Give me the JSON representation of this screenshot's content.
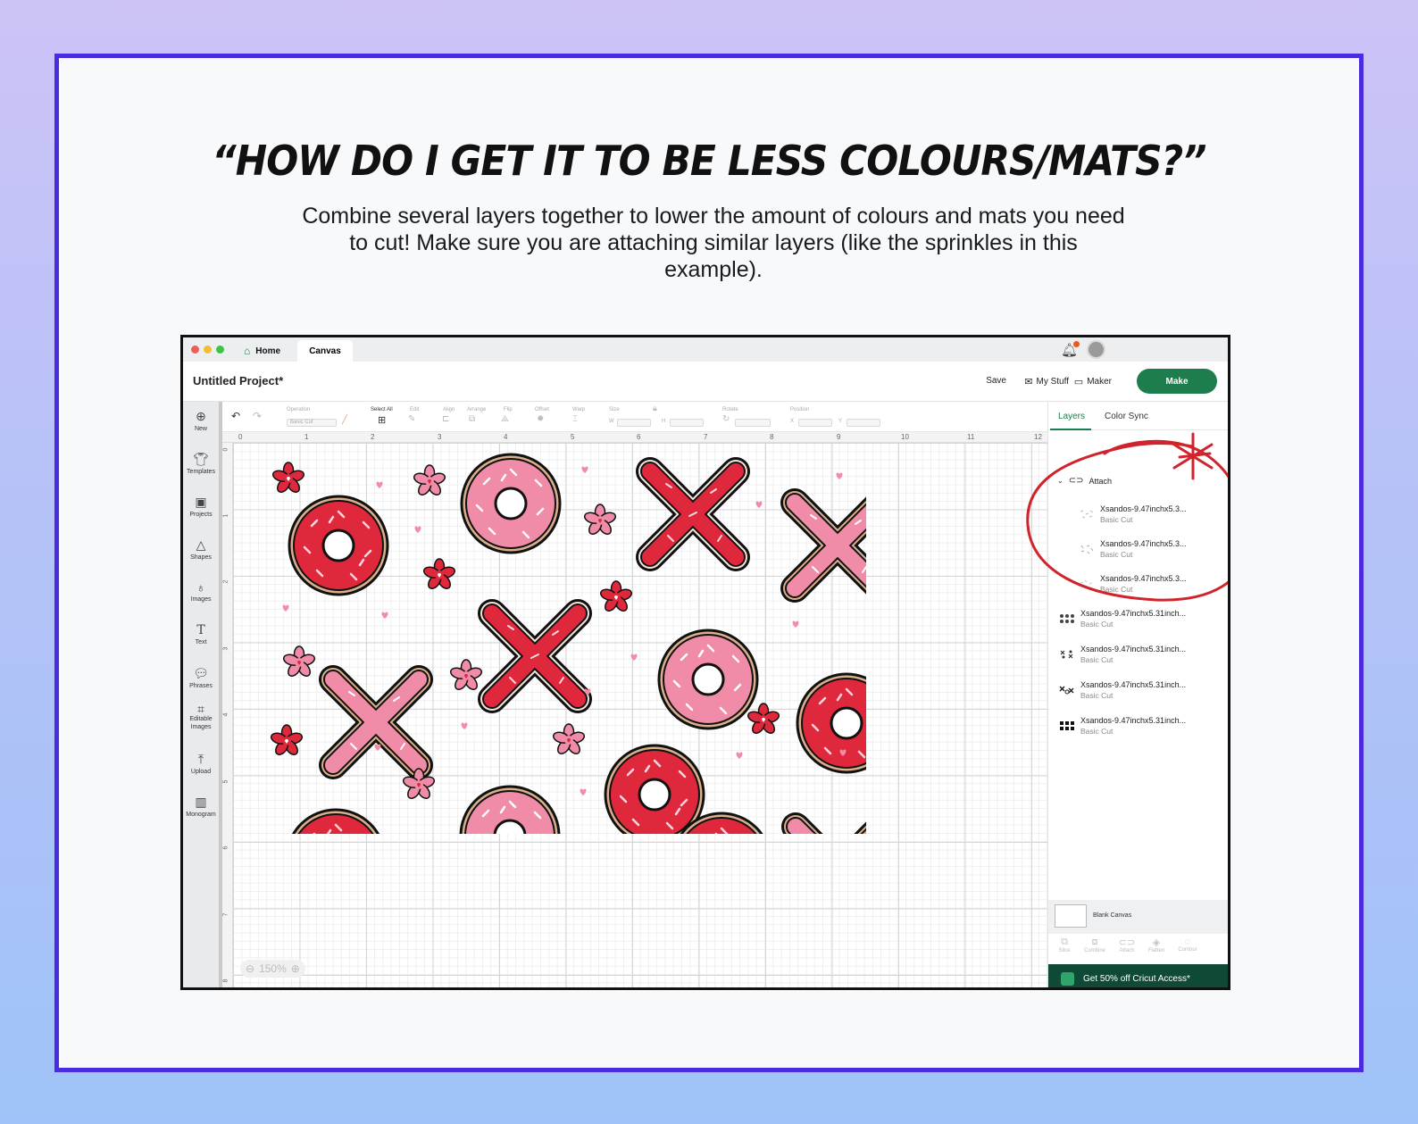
{
  "headline": "“HOW DO I GET IT TO BE LESS COLOURS/MATS?”",
  "subtext": "Combine several layers together to lower the amount of colours and mats you need to cut! Make sure you are attaching similar layers (like the sprinkles in this example).",
  "app": {
    "tabs": {
      "home": "Home",
      "canvas": "Canvas"
    },
    "project_title": "Untitled Project*",
    "header": {
      "save": "Save",
      "my_stuff": "My Stuff",
      "maker": "Maker",
      "make": "Make"
    },
    "left_tools": [
      {
        "label": "New",
        "icon": "plus-circle-icon"
      },
      {
        "label": "Templates",
        "icon": "shirt-icon"
      },
      {
        "label": "Projects",
        "icon": "projects-icon"
      },
      {
        "label": "Shapes",
        "icon": "shapes-icon"
      },
      {
        "label": "Images",
        "icon": "bulb-icon"
      },
      {
        "label": "Text",
        "icon": "text-icon"
      },
      {
        "label": "Phrases",
        "icon": "speech-bubble-icon"
      },
      {
        "label": "Editable Images",
        "icon": "edit-image-icon"
      },
      {
        "label": "Upload",
        "icon": "upload-icon"
      },
      {
        "label": "Monogram",
        "icon": "monogram-icon"
      }
    ],
    "toolbar": {
      "operation": "Operation",
      "operation_value": "Basic Cut",
      "select_all": "Select All",
      "edit": "Edit",
      "align": "Align",
      "arrange": "Arrange",
      "flip": "Flip",
      "offset": "Offset",
      "warp": "Warp",
      "size": "Size",
      "w": "W",
      "h": "H",
      "rotate": "Rotate",
      "position": "Position",
      "x": "X",
      "y": "Y"
    },
    "ruler_top": [
      "0",
      "1",
      "2",
      "3",
      "4",
      "5",
      "6",
      "7",
      "8",
      "9",
      "10",
      "11",
      "12"
    ],
    "ruler_left": [
      "0",
      "1",
      "2",
      "3",
      "4",
      "5",
      "6",
      "7",
      "8"
    ],
    "zoom": "150%",
    "panel": {
      "tabs": [
        "Layers",
        "Color Sync"
      ],
      "attach_label": "Attach",
      "attached_layers": [
        {
          "name": "Xsandos-9.47inchx5.3...",
          "op": "Basic Cut"
        },
        {
          "name": "Xsandos-9.47inchx5.3...",
          "op": "Basic Cut"
        },
        {
          "name": "Xsandos-9.47inchx5.3...",
          "op": "Basic Cut"
        }
      ],
      "layers": [
        {
          "name": "Xsandos-9.47inchx5.31inch...",
          "op": "Basic Cut"
        },
        {
          "name": "Xsandos-9.47inchx5.31inch...",
          "op": "Basic Cut"
        },
        {
          "name": "Xsandos-9.47inchx5.31inch...",
          "op": "Basic Cut"
        },
        {
          "name": "Xsandos-9.47inchx5.31inch...",
          "op": "Basic Cut"
        }
      ],
      "blank_canvas": "Blank Canvas",
      "tools": [
        "Slice",
        "Combine",
        "Attach",
        "Flatten",
        "Contour"
      ],
      "promo": "Get 50% off Cricut Access*"
    }
  },
  "colors": {
    "frame": "#4b2be0",
    "make_button": "#1d7d4d",
    "annotation": "#d0242c",
    "red_donut": "#e0283c",
    "pink_donut": "#f08ca7"
  }
}
